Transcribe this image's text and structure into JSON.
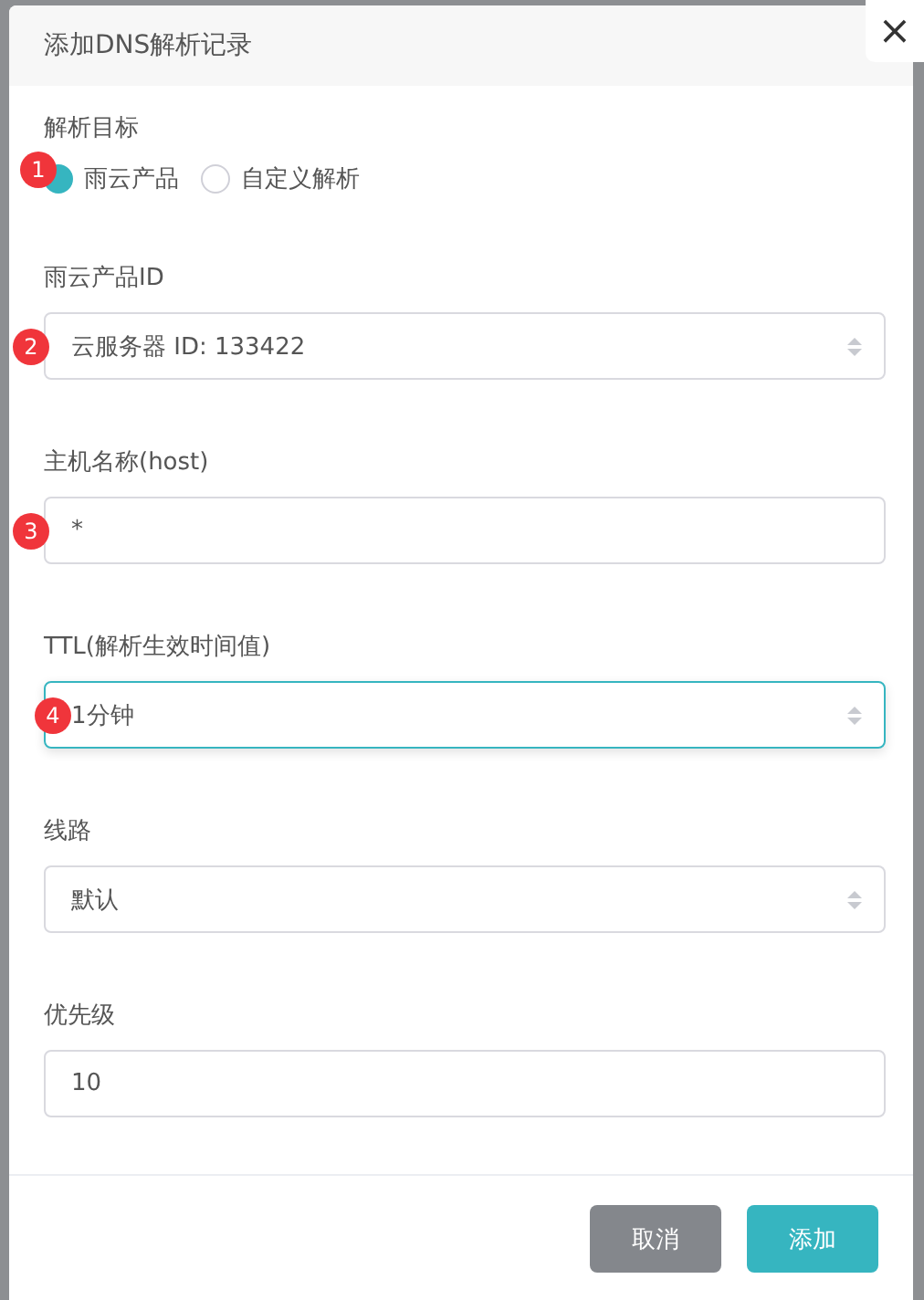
{
  "dialog": {
    "title": "添加DNS解析记录",
    "close": "×"
  },
  "target": {
    "label": "解析目标",
    "badge": "1",
    "options": [
      {
        "label": "雨云产品",
        "selected": true
      },
      {
        "label": "自定义解析",
        "selected": false
      }
    ]
  },
  "fields": [
    {
      "label": "雨云产品ID",
      "kind": "select",
      "value": "云服务器 ID: 133422",
      "focused": false,
      "badge": "2"
    },
    {
      "label": "主机名称(host)",
      "kind": "input",
      "value": "*",
      "focused": false,
      "badge": "3"
    },
    {
      "label": "TTL(解析生效时间值)",
      "kind": "select",
      "value": "1分钟",
      "focused": true,
      "badge": "4"
    },
    {
      "label": "线路",
      "kind": "select",
      "value": "默认",
      "focused": false
    },
    {
      "label": "优先级",
      "kind": "input",
      "value": "10",
      "focused": false
    }
  ],
  "buttons": [
    {
      "label": "取消",
      "kind": "secondary"
    },
    {
      "label": "添加",
      "kind": "primary"
    }
  ]
}
